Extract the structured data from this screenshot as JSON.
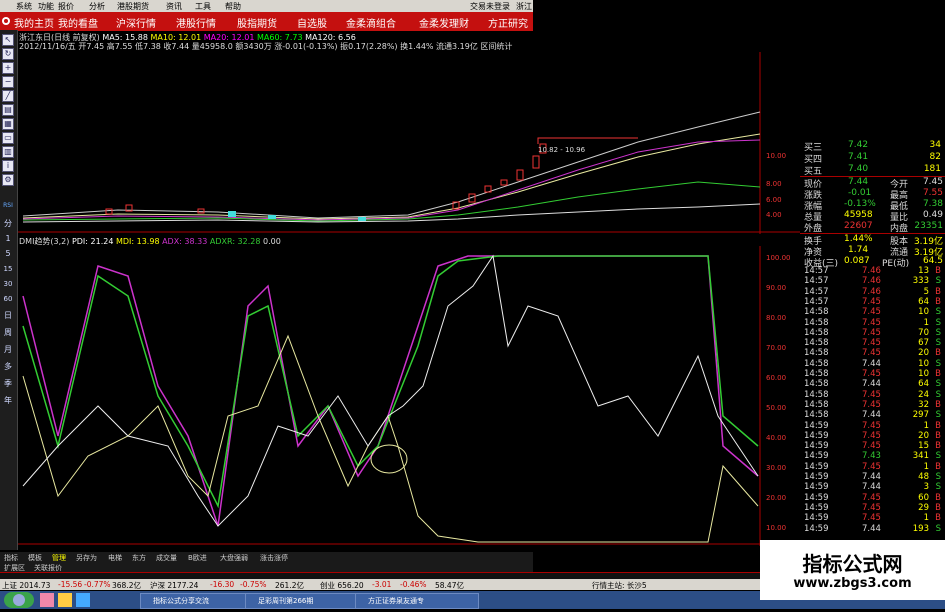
{
  "menu": {
    "items": [
      "系统",
      "功能",
      "报价",
      "分析",
      "港股期货",
      "资讯",
      "工具",
      "帮助"
    ],
    "login": "交易未登录",
    "login_right": "浙江"
  },
  "nav": {
    "tabs": [
      "我的主页",
      "我的看盘",
      "沪深行情",
      "港股行情",
      "股指期货",
      "自选股",
      "金柔滴组合",
      "金柔发理财",
      "方正研究"
    ]
  },
  "left_toolbar": {
    "labels": [
      "RSI",
      "分",
      "1",
      "5",
      "15",
      "30",
      "60",
      "日",
      "周",
      "月",
      "多",
      "季",
      "年"
    ]
  },
  "kline_header": {
    "line1": "浙江东日(日线 前复权)",
    "ma_label": "MA5: 15.88",
    "ma10": "MA10: 12.01",
    "ma20": "MA20: 12.01",
    "ma60": "MA60: 7.73",
    "ma120": "MA120: 6.56",
    "line2": "2012/11/16/五 开7.45 高7.55 低7.38 收7.44 量45958.0 额3430万 涨-0.01(-0.13%) 振0.17(2.28%) 换1.44% 流通3.19亿 区间统计",
    "price_label": "10.82 - 10.96"
  },
  "dmi_header": {
    "name": "DMI趋势(3,2)",
    "pdi": "PDI: 21.24",
    "mdi": "MDI: 13.98",
    "adx": "ADX: 38.33",
    "adxr": "ADXR: 32.28",
    "extra": "0.00"
  },
  "price_axis": [
    "10.00",
    "8.00",
    "6.00",
    "4.00"
  ],
  "dmi_axis": [
    "100.00",
    "90.00",
    "80.00",
    "70.00",
    "60.00",
    "50.00",
    "40.00",
    "30.00",
    "20.00",
    "10.00"
  ],
  "quote": {
    "asks": [
      {
        "label": "买三",
        "price": "7.42",
        "vol": "34"
      },
      {
        "label": "买四",
        "price": "7.41",
        "vol": "82"
      },
      {
        "label": "买五",
        "price": "7.40",
        "vol": "181"
      }
    ],
    "stats": [
      {
        "l1": "现价",
        "v1": "7.44",
        "l2": "今开",
        "v2": "7.45"
      },
      {
        "l1": "涨跌",
        "v1": "-0.01",
        "l2": "最高",
        "v2": "7.55"
      },
      {
        "l1": "涨幅",
        "v1": "-0.13%",
        "l2": "最低",
        "v2": "7.38"
      },
      {
        "l1": "总量",
        "v1": "45958",
        "l2": "量比",
        "v2": "0.49"
      },
      {
        "l1": "外盘",
        "v1": "22607",
        "l2": "内盘",
        "v2": "23351"
      },
      {
        "l1": "换手",
        "v1": "1.44%",
        "l2": "股本",
        "v2": "3.19亿"
      },
      {
        "l1": "净资",
        "v1": "1.74",
        "l2": "流通",
        "v2": "3.19亿"
      },
      {
        "l1": "收益(三)",
        "v1": "0.087",
        "l2": "PE(动)",
        "v2": "64.5"
      }
    ]
  },
  "ticks": [
    {
      "time": "14:57",
      "price": "7.46",
      "vol": "13",
      "side": "B"
    },
    {
      "time": "14:57",
      "price": "7.46",
      "vol": "333",
      "side": "S"
    },
    {
      "time": "14:57",
      "price": "7.46",
      "vol": "5",
      "side": "B"
    },
    {
      "time": "14:57",
      "price": "7.45",
      "vol": "64",
      "side": "B"
    },
    {
      "time": "14:58",
      "price": "7.45",
      "vol": "10",
      "side": "S"
    },
    {
      "time": "14:58",
      "price": "7.45",
      "vol": "1",
      "side": "S"
    },
    {
      "time": "14:58",
      "price": "7.45",
      "vol": "70",
      "side": "S"
    },
    {
      "time": "14:58",
      "price": "7.45",
      "vol": "67",
      "side": "S"
    },
    {
      "time": "14:58",
      "price": "7.45",
      "vol": "20",
      "side": "B"
    },
    {
      "time": "14:58",
      "price": "7.44",
      "vol": "10",
      "side": "S"
    },
    {
      "time": "14:58",
      "price": "7.45",
      "vol": "10",
      "side": "B"
    },
    {
      "time": "14:58",
      "price": "7.44",
      "vol": "64",
      "side": "S"
    },
    {
      "time": "14:58",
      "price": "7.45",
      "vol": "24",
      "side": "S"
    },
    {
      "time": "14:58",
      "price": "7.45",
      "vol": "32",
      "side": "B"
    },
    {
      "time": "14:58",
      "price": "7.44",
      "vol": "297",
      "side": "S"
    },
    {
      "time": "14:59",
      "price": "7.45",
      "vol": "1",
      "side": "B"
    },
    {
      "time": "14:59",
      "price": "7.45",
      "vol": "20",
      "side": "B"
    },
    {
      "time": "14:59",
      "price": "7.45",
      "vol": "15",
      "side": "B"
    },
    {
      "time": "14:59",
      "price": "7.43",
      "vol": "341",
      "side": "S"
    },
    {
      "time": "14:59",
      "price": "7.45",
      "vol": "1",
      "side": "B"
    },
    {
      "time": "14:59",
      "price": "7.44",
      "vol": "48",
      "side": "S"
    },
    {
      "time": "14:59",
      "price": "7.44",
      "vol": "3",
      "side": "S"
    },
    {
      "time": "14:59",
      "price": "7.45",
      "vol": "60",
      "side": "B"
    },
    {
      "time": "14:59",
      "price": "7.45",
      "vol": "29",
      "side": "B"
    },
    {
      "time": "14:59",
      "price": "7.45",
      "vol": "1",
      "side": "B"
    },
    {
      "time": "14:59",
      "price": "7.44",
      "vol": "193",
      "side": "S"
    }
  ],
  "bottom_tabs1": [
    "指标",
    "模板",
    "管理",
    "另存为",
    "电梯",
    "东方",
    "成交量",
    "B欧进",
    "大盘强弱",
    "涨击涨停"
  ],
  "bottom_tabs2": [
    "扩展区",
    "关联报价"
  ],
  "status": {
    "sh": "上证 2014.73",
    "sh_chg": "-15.56",
    "sh_pct": "-0.77%",
    "sh_amt": "368.2亿",
    "sz": "沪深 2177.24",
    "sz_chg": "-16.30",
    "sz_pct": "-0.75%",
    "sz_amt": "261.2亿",
    "cy": "创业 656.20",
    "cy_chg": "-3.01",
    "cy_pct": "-0.46%",
    "cy_amt": "58.47亿",
    "source": "行情主站: 长沙5"
  },
  "taskbar": {
    "items": [
      "指标公式分享交流",
      "足彩周刊第266期",
      "方正证券泉友通专"
    ]
  },
  "watermark": {
    "title": "指标公式网",
    "url": "www.zbgs3.com"
  },
  "colors": {
    "menu_bg": "#d9d6cf",
    "nav_red": "#c4100f",
    "up_red": "#ff3b3b",
    "down_green": "#33cc33",
    "pdi": "#ffffff",
    "mdi": "#b8e05a",
    "adx": "#cc44cc",
    "adxr": "#44dd44"
  }
}
